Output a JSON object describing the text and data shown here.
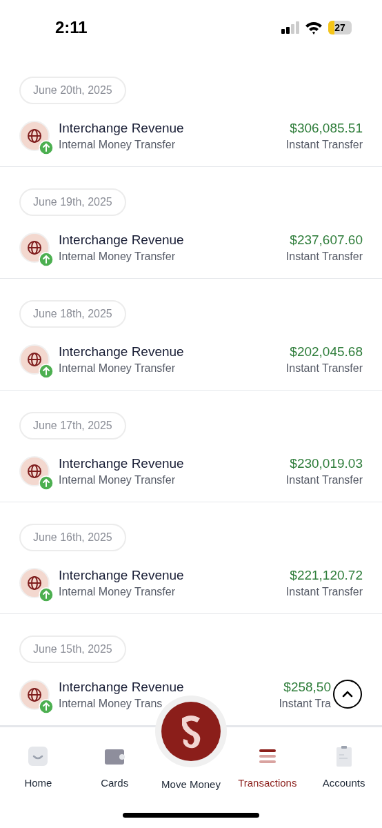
{
  "status_bar": {
    "time": "2:11",
    "battery": "27"
  },
  "groups": [
    {
      "date": "June 20th, 2025",
      "title": "Interchange Revenue",
      "subtitle": "Internal Money Transfer",
      "amount": "$306,085.51",
      "method": "Instant Transfer"
    },
    {
      "date": "June 19th, 2025",
      "title": "Interchange Revenue",
      "subtitle": "Internal Money Transfer",
      "amount": "$237,607.60",
      "method": "Instant Transfer"
    },
    {
      "date": "June 18th, 2025",
      "title": "Interchange Revenue",
      "subtitle": "Internal Money Transfer",
      "amount": "$202,045.68",
      "method": "Instant Transfer"
    },
    {
      "date": "June 17th, 2025",
      "title": "Interchange Revenue",
      "subtitle": "Internal Money Transfer",
      "amount": "$230,019.03",
      "method": "Instant Transfer"
    },
    {
      "date": "June 16th, 2025",
      "title": "Interchange Revenue",
      "subtitle": "Internal Money Transfer",
      "amount": "$221,120.72",
      "method": "Instant Transfer"
    },
    {
      "date": "June 15th, 2025",
      "title": "Interchange Revenue",
      "subtitle": "Internal Money Trans",
      "amount": "$258,50",
      "method": "Instant Tra"
    }
  ],
  "nav": [
    {
      "kind": "home",
      "label": "Home",
      "selected": false
    },
    {
      "kind": "cards",
      "label": "Cards",
      "selected": false
    },
    {
      "kind": "move",
      "label": "Move Money",
      "selected": false
    },
    {
      "kind": "transactions",
      "label": "Transactions",
      "selected": true
    },
    {
      "kind": "accounts",
      "label": "Accounts",
      "selected": false
    }
  ]
}
